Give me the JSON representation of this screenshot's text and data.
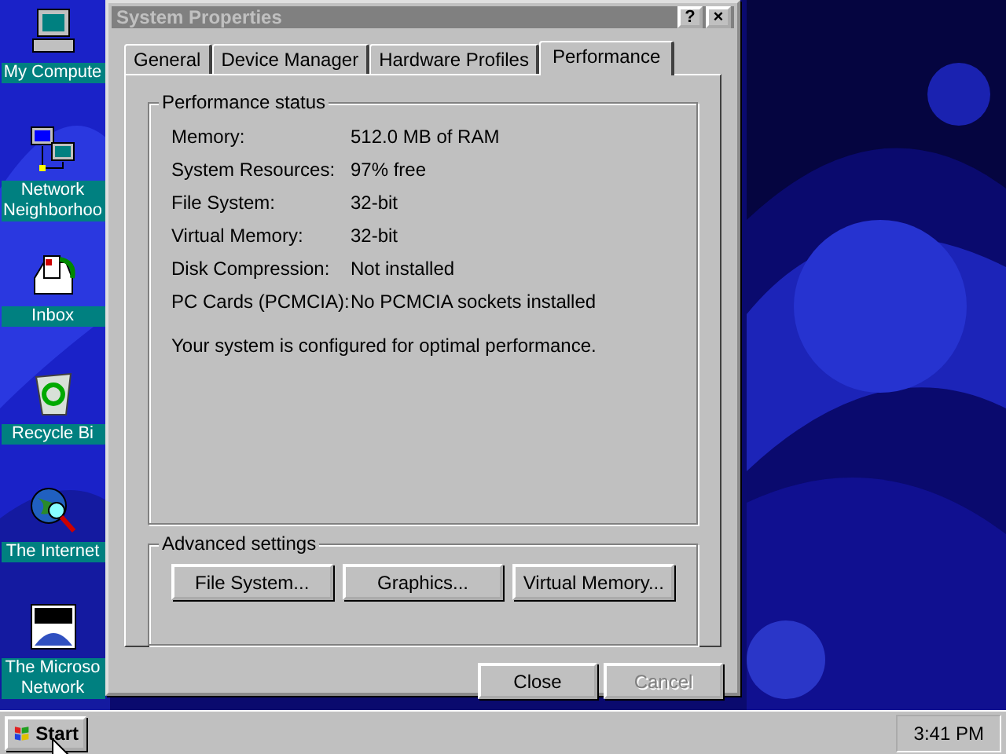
{
  "desktop_icons": [
    {
      "kind": "computer",
      "label": "My Compute"
    },
    {
      "kind": "network",
      "label": "Network Neighborhoo"
    },
    {
      "kind": "inbox",
      "label": "Inbox"
    },
    {
      "kind": "recycle",
      "label": "Recycle Bi"
    },
    {
      "kind": "internet",
      "label": "The Internet"
    },
    {
      "kind": "msn",
      "label": "The Microso Network"
    }
  ],
  "window": {
    "title": "System Properties",
    "title_buttons": [
      "?",
      "×"
    ],
    "tabs": [
      {
        "label": "General",
        "selected": false
      },
      {
        "label": "Device Manager",
        "selected": false
      },
      {
        "label": "Hardware Profiles",
        "selected": false
      },
      {
        "label": "Performance",
        "selected": true
      }
    ],
    "status_group": {
      "title": "Performance status",
      "rows": [
        {
          "label": "Memory:",
          "value": "512.0 MB of RAM"
        },
        {
          "label": "System Resources:",
          "value": "97% free"
        },
        {
          "label": "File System:",
          "value": "32-bit"
        },
        {
          "label": "Virtual Memory:",
          "value": "32-bit"
        },
        {
          "label": "Disk Compression:",
          "value": "Not installed"
        },
        {
          "label": "PC Cards (PCMCIA):",
          "value": "No PCMCIA sockets installed"
        }
      ],
      "note": "Your system is configured for optimal performance."
    },
    "advanced_group": {
      "title": "Advanced settings",
      "buttons": [
        "File System...",
        "Graphics...",
        "Virtual Memory..."
      ]
    },
    "dialog_buttons": [
      {
        "label": "Close",
        "disabled": false
      },
      {
        "label": "Cancel",
        "disabled": true
      }
    ]
  },
  "taskbar": {
    "start_label": "Start",
    "clock": "3:41 PM"
  }
}
